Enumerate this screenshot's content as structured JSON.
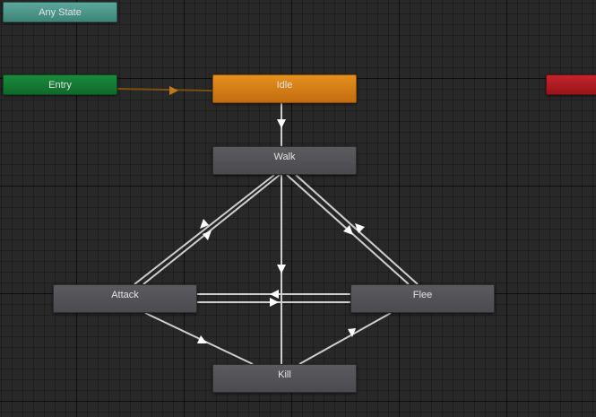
{
  "graph": {
    "states": {
      "any_state": {
        "label": "Any State"
      },
      "entry": {
        "label": "Entry"
      },
      "idle": {
        "label": "Idle",
        "is_default": true
      },
      "exit": {
        "label": ""
      },
      "walk": {
        "label": "Walk"
      },
      "attack": {
        "label": "Attack"
      },
      "flee": {
        "label": "Flee"
      },
      "kill": {
        "label": "Kill"
      }
    },
    "transitions": [
      {
        "from": "entry",
        "to": "idle"
      },
      {
        "from": "idle",
        "to": "walk"
      },
      {
        "from": "walk",
        "to": "kill"
      },
      {
        "from": "walk",
        "to": "attack"
      },
      {
        "from": "attack",
        "to": "walk"
      },
      {
        "from": "walk",
        "to": "flee"
      },
      {
        "from": "flee",
        "to": "walk"
      },
      {
        "from": "attack",
        "to": "flee"
      },
      {
        "from": "flee",
        "to": "attack"
      },
      {
        "from": "attack",
        "to": "kill"
      },
      {
        "from": "kill",
        "to": "flee"
      }
    ]
  },
  "colors": {
    "background": "#282828",
    "transition": "#cfcfcf",
    "entry_transition": "#8a5a10",
    "state_normal": "#55555a",
    "state_default": "#d9801a",
    "state_entry": "#158136",
    "state_any": "#4f9a8e",
    "state_exit": "#b11a22"
  }
}
